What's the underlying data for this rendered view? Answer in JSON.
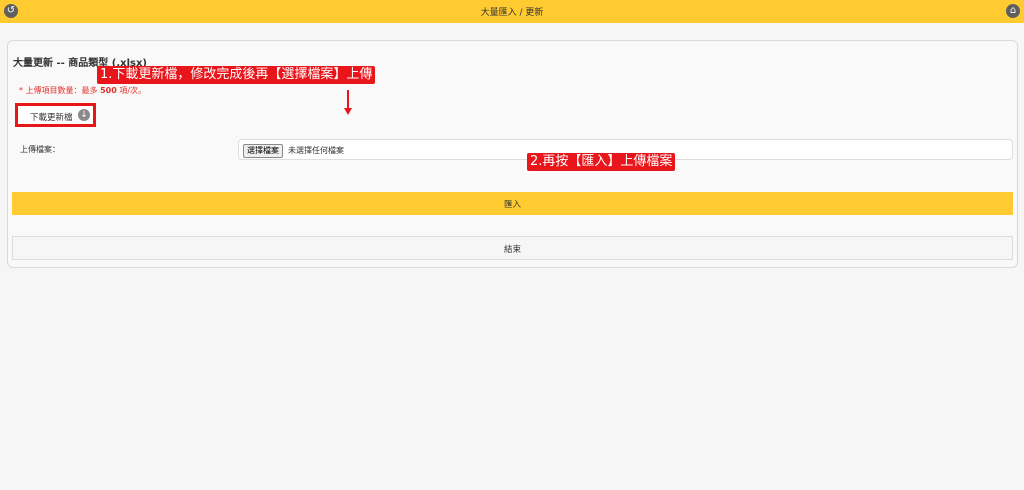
{
  "topbar": {
    "title": "大量匯入 / 更新",
    "back_icon": "back-icon",
    "home_icon": "home-icon"
  },
  "page": {
    "title": "大量更新 -- 商品類型 (.xlsx)",
    "note_prefix": "* 上傳項目數量：最多 ",
    "note_count": "500",
    "note_suffix": " 項/次。"
  },
  "download": {
    "label": "下載更新檔",
    "icon": "download-circle-icon"
  },
  "annotations": {
    "step1": "1.下載更新檔，修改完成後再【選擇檔案】上傳",
    "step2": "2.再按【匯入】上傳檔案"
  },
  "upload": {
    "label": "上傳檔案：",
    "choose_button": "選擇檔案",
    "no_file_text": "未選擇任何檔案"
  },
  "import": {
    "label": "匯入"
  },
  "end": {
    "label": "結束"
  },
  "colors": {
    "accent": "#ffcb31",
    "annotation": "#e8151b",
    "note": "#e5322b"
  }
}
